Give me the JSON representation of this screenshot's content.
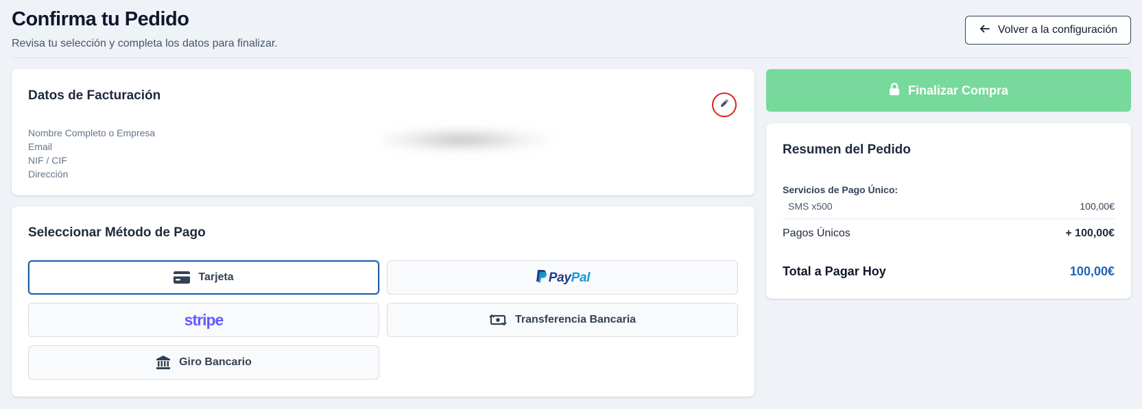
{
  "header": {
    "title": "Confirma tu Pedido",
    "subtitle": "Revisa tu selección y completa los datos para finalizar.",
    "back_label": "Volver a la configuración"
  },
  "billing": {
    "title": "Datos de Facturación",
    "labels": [
      "Nombre Completo o Empresa",
      "Email",
      "NIF / CIF",
      "Dirección"
    ]
  },
  "payment": {
    "title": "Seleccionar Método de Pago",
    "selected": "Tarjeta",
    "options": {
      "tarjeta": "Tarjeta",
      "paypal_pay": "Pay",
      "paypal_pal": "Pal",
      "stripe": "stripe",
      "transfer": "Transferencia Bancaria",
      "giro": "Giro Bancario"
    }
  },
  "checkout": {
    "finalize_label": "Finalizar Compra"
  },
  "summary": {
    "title": "Resumen del Pedido",
    "section_label": "Servicios de Pago Único:",
    "item_name": "SMS x500",
    "item_price": "100,00€",
    "subtotal_label": "Pagos Únicos",
    "subtotal_value": "+ 100,00€",
    "total_label": "Total a Pagar Hoy",
    "total_value": "100,00€"
  },
  "colors": {
    "accent": "#1d63b5",
    "finalize_button": "#77d99b",
    "highlight_ring": "#e11d1d",
    "paypal_dark": "#253b80",
    "paypal_light": "#179bd7",
    "stripe": "#635bff"
  },
  "icons": [
    "arrow-left-icon",
    "pencil-icon",
    "credit-card-icon",
    "paypal-logo",
    "stripe-logo",
    "money-transfer-icon",
    "bank-icon",
    "lock-icon"
  ]
}
